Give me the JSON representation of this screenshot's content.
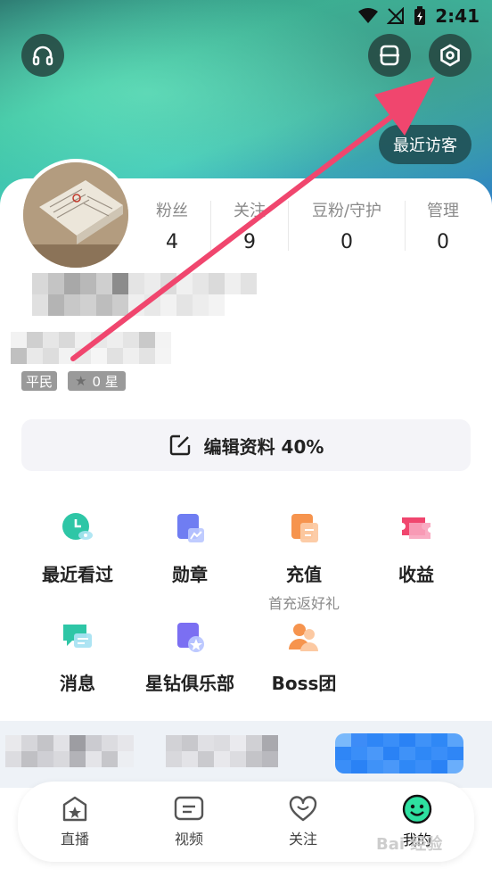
{
  "status_bar": {
    "time": "2:41"
  },
  "header": {
    "recent_visitors_label": "最近访客"
  },
  "stats": [
    {
      "label": "粉丝",
      "value": "4"
    },
    {
      "label": "关注",
      "value": "9"
    },
    {
      "label": "豆粉/守护",
      "value": "0"
    },
    {
      "label": "管理",
      "value": "0"
    }
  ],
  "badges": {
    "rank": "平民",
    "stars": "0 星"
  },
  "edit_profile": {
    "label": "编辑资料 40%"
  },
  "menu": [
    {
      "label": "最近看过",
      "sub": "",
      "icon": "clock-icon"
    },
    {
      "label": "勋章",
      "sub": "",
      "icon": "medal-icon"
    },
    {
      "label": "充值",
      "sub": "首充返好礼",
      "icon": "recharge-icon"
    },
    {
      "label": "收益",
      "sub": "",
      "icon": "earnings-icon"
    },
    {
      "label": "消息",
      "sub": "",
      "icon": "message-icon"
    },
    {
      "label": "星钻俱乐部",
      "sub": "",
      "icon": "star-diamond-icon"
    },
    {
      "label": "Boss团",
      "sub": "",
      "icon": "boss-group-icon"
    }
  ],
  "nav": [
    {
      "label": "直播",
      "icon": "live-icon"
    },
    {
      "label": "视频",
      "icon": "video-icon"
    },
    {
      "label": "关注",
      "icon": "heart-icon"
    },
    {
      "label": "我的",
      "icon": "smiley-icon"
    }
  ],
  "colors": {
    "accent_teal": "#2ec6a6",
    "arrow": "#f0466e"
  },
  "watermark": "Bai 经验"
}
